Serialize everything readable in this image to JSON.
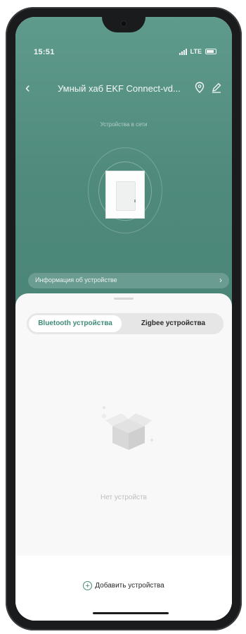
{
  "status_bar": {
    "time": "15:51",
    "network": "LTE"
  },
  "nav": {
    "title": "Умный хаб EKF Connect-vd..."
  },
  "hero": {
    "subtitle": "Устройства в сети"
  },
  "info_bar": {
    "label": "Информация об устройстве"
  },
  "tabs": [
    {
      "label": "Bluetooth устройства",
      "active": true
    },
    {
      "label": "Zigbee устройства",
      "active": false
    }
  ],
  "empty_state": {
    "text": "Нет устройств"
  },
  "add_button": {
    "label": "Добавить устройства"
  },
  "colors": {
    "header_teal": "#4f8a7c",
    "accent_green": "#3e8a76",
    "sheet_bg": "#f8f8f8"
  }
}
